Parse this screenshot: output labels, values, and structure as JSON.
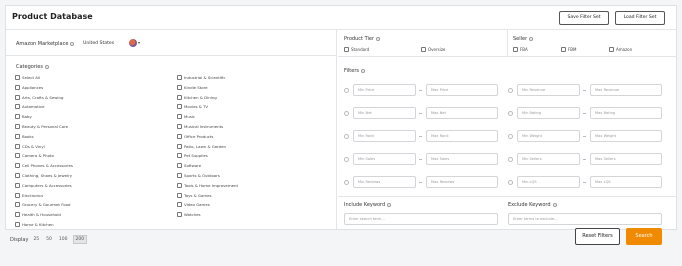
{
  "header": {
    "title": "Product Database",
    "save_filter_label": "Save Filter Set",
    "load_filter_label": "Load Filter Set"
  },
  "marketplace": {
    "label": "Amazon Marketplace",
    "value": "United States"
  },
  "categories": {
    "title": "Categories",
    "col1": [
      "Select All",
      "Appliances",
      "Arts, Crafts & Sewing",
      "Automotive",
      "Baby",
      "Beauty & Personal Care",
      "Books",
      "CDs & Vinyl",
      "Camera & Photo",
      "Cell Phones & Accessories",
      "Clothing, Shoes & Jewelry",
      "Computers & Accessories",
      "Electronics",
      "Grocery & Gourmet Food",
      "Health & Household",
      "Home & Kitchen"
    ],
    "col2": [
      "Industrial & Scientific",
      "Kindle Store",
      "Kitchen & Dining",
      "Movies & TV",
      "Music",
      "Musical Instruments",
      "Office Products",
      "Patio, Lawn & Garden",
      "Pet Supplies",
      "Software",
      "Sports & Outdoors",
      "Tools & Home Improvement",
      "Toys & Games",
      "Video Games",
      "Watches"
    ]
  },
  "product_tier": {
    "title": "Product Tier",
    "options": [
      "Standard",
      "Oversize"
    ]
  },
  "seller": {
    "title": "Seller",
    "options": [
      "FBA",
      "FBM",
      "Amazon"
    ]
  },
  "filters": {
    "title": "Filters",
    "rows": [
      [
        "Min Price",
        "Max Price",
        "Min Revenue",
        "Max Revenue"
      ],
      [
        "Min Net",
        "Max Net",
        "Min Rating",
        "Max Rating"
      ],
      [
        "Min Rank",
        "Max Rank",
        "Min Weight",
        "Max Weight"
      ],
      [
        "Min Sales",
        "Max Sales",
        "Min Sellers",
        "Max Sellers"
      ],
      [
        "Min Reviews",
        "Max Reviews",
        "Min LQS",
        "Max LQS"
      ]
    ]
  },
  "include_keyword": {
    "title": "Include Keyword",
    "placeholder": "Enter search term..."
  },
  "exclude_keyword": {
    "title": "Exclude Keyword",
    "placeholder": "Enter terms to exclude..."
  },
  "display": {
    "label": "Display",
    "options": [
      "25",
      "50",
      "100",
      "200"
    ],
    "selected": "200"
  },
  "actions": {
    "reset_label": "Reset Filters",
    "search_label": "Search"
  },
  "colors": {
    "accent": "#f08a00"
  }
}
